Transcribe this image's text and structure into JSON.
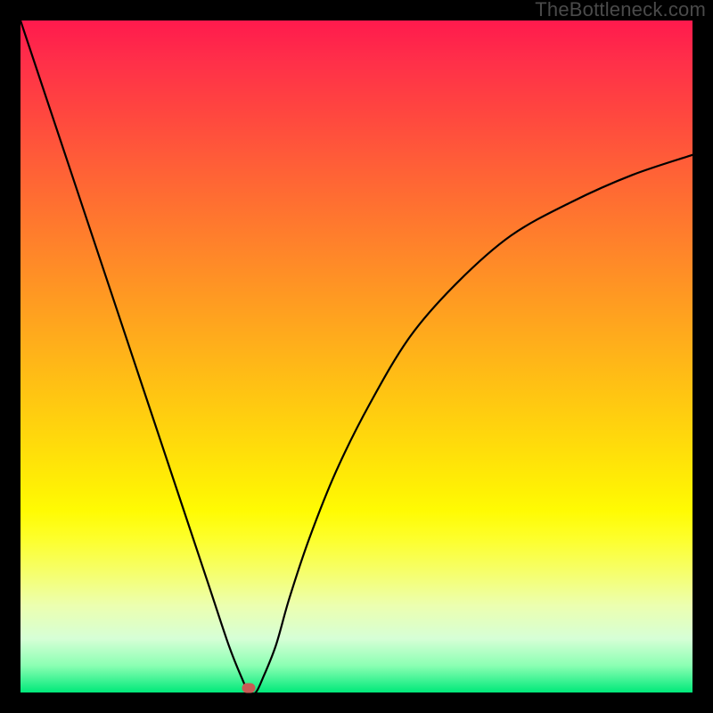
{
  "watermark": "TheBottleneck.com",
  "marker": {
    "x_ratio": 0.34,
    "y_ratio": 0.993,
    "color": "#c85a54"
  },
  "chart_data": {
    "type": "line",
    "title": "",
    "xlabel": "",
    "ylabel": "",
    "xlim": [
      0,
      100
    ],
    "ylim": [
      0,
      100
    ],
    "series": [
      {
        "name": "bottleneck-curve",
        "x": [
          0,
          4,
          8,
          12,
          16,
          20,
          24,
          28,
          31,
          33,
          34,
          35,
          36,
          38,
          40,
          43,
          47,
          52,
          58,
          65,
          73,
          82,
          91,
          100
        ],
        "values": [
          100,
          88,
          76,
          64,
          52,
          40,
          28,
          16,
          7,
          2,
          0,
          0,
          2,
          7,
          14,
          23,
          33,
          43,
          53,
          61,
          68,
          73,
          77,
          80
        ]
      }
    ],
    "annotations": [
      {
        "type": "point",
        "name": "current-config",
        "x": 34,
        "y": 0.7
      }
    ],
    "background_gradient": {
      "orientation": "vertical",
      "stops": [
        {
          "pos": 0.0,
          "color": "#ff1a4d"
        },
        {
          "pos": 0.5,
          "color": "#ffae1b"
        },
        {
          "pos": 0.75,
          "color": "#fffe05"
        },
        {
          "pos": 1.0,
          "color": "#00e97a"
        }
      ]
    }
  }
}
